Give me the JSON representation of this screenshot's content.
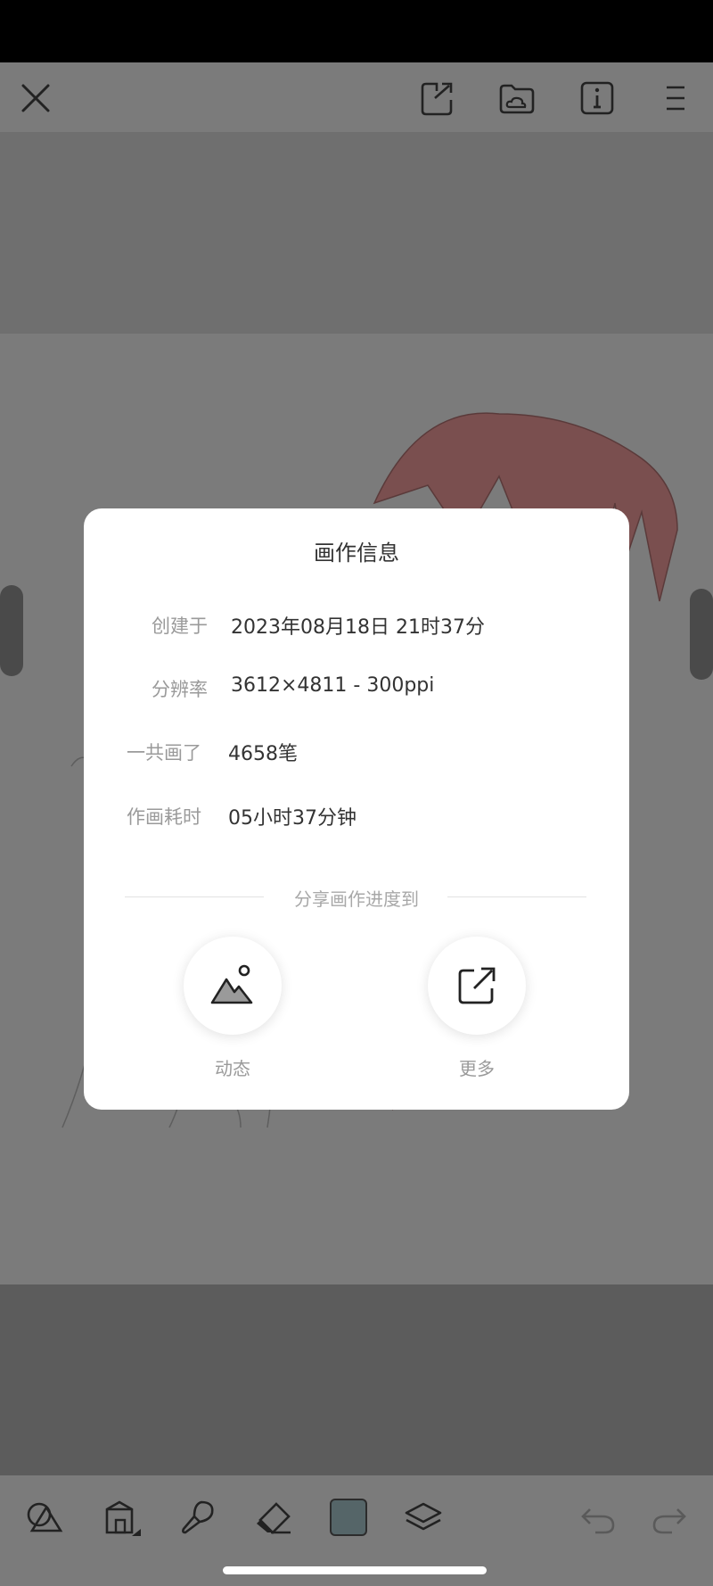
{
  "top_toolbar": {
    "icons": [
      "close-icon",
      "export-icon",
      "cloud-folder-icon",
      "info-icon",
      "menu-icon"
    ]
  },
  "bottom_toolbar": {
    "icons": [
      "shapes-icon",
      "paint-bucket-icon",
      "brush-icon",
      "eraser-icon",
      "color-swatch",
      "layers-icon",
      "undo-icon",
      "redo-icon"
    ],
    "current_color": "#556568"
  },
  "dialog": {
    "title": "画作信息",
    "rows": [
      {
        "label": "创建于",
        "value": "2023年08月18日 21时37分"
      },
      {
        "label": "分辨率",
        "value": "3612×4811 - 300ppi"
      },
      {
        "label": "一共画了",
        "value": "4658笔"
      },
      {
        "label": "作画耗时",
        "value": "05小时37分钟"
      }
    ],
    "share_heading": "分享画作进度到",
    "share_buttons": [
      {
        "label": "动态",
        "icon": "image-mountain-icon"
      },
      {
        "label": "更多",
        "icon": "external-share-icon"
      }
    ]
  }
}
